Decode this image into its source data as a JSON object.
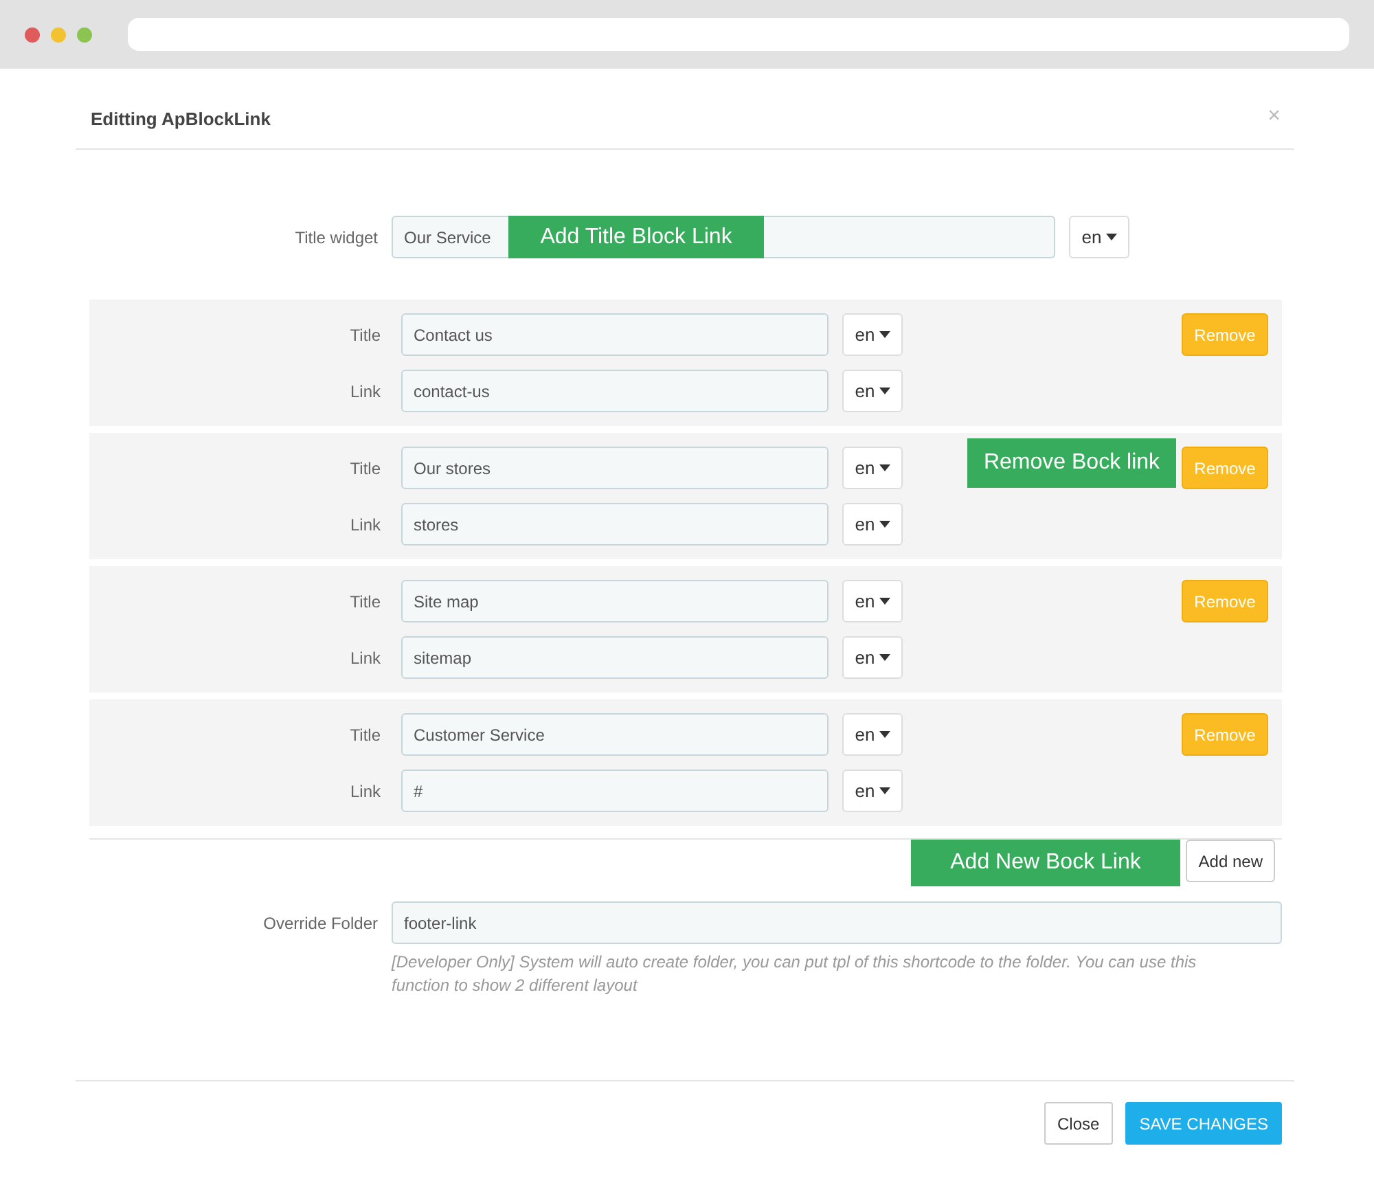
{
  "dialog": {
    "title": "Editting ApBlockLink",
    "close": "×"
  },
  "title_widget": {
    "label": "Title widget",
    "value": "Our Service",
    "lang": "en",
    "callout": "Add Title Block Link"
  },
  "links": [
    {
      "title_label": "Title",
      "title_value": "Contact us",
      "title_lang": "en",
      "link_label": "Link",
      "link_value": "contact-us",
      "link_lang": "en",
      "remove": "Remove"
    },
    {
      "title_label": "Title",
      "title_value": "Our stores",
      "title_lang": "en",
      "link_label": "Link",
      "link_value": "stores",
      "link_lang": "en",
      "remove": "Remove",
      "callout": "Remove Bock link"
    },
    {
      "title_label": "Title",
      "title_value": "Site map",
      "title_lang": "en",
      "link_label": "Link",
      "link_value": "sitemap",
      "link_lang": "en",
      "remove": "Remove"
    },
    {
      "title_label": "Title",
      "title_value": "Customer Service",
      "title_lang": "en",
      "link_label": "Link",
      "link_value": "#",
      "link_lang": "en",
      "remove": "Remove"
    }
  ],
  "add": {
    "button": "Add new",
    "callout": "Add New Bock Link"
  },
  "override": {
    "label": "Override Folder",
    "value": "footer-link",
    "help": "[Developer Only] System will auto create folder, you can put tpl of this shortcode to the folder. You can use this function to show 2 different layout"
  },
  "footer": {
    "buttons": [
      {
        "label": "Close",
        "kind": "default"
      },
      {
        "label": "SAVE CHANGES",
        "kind": "primary"
      }
    ]
  }
}
